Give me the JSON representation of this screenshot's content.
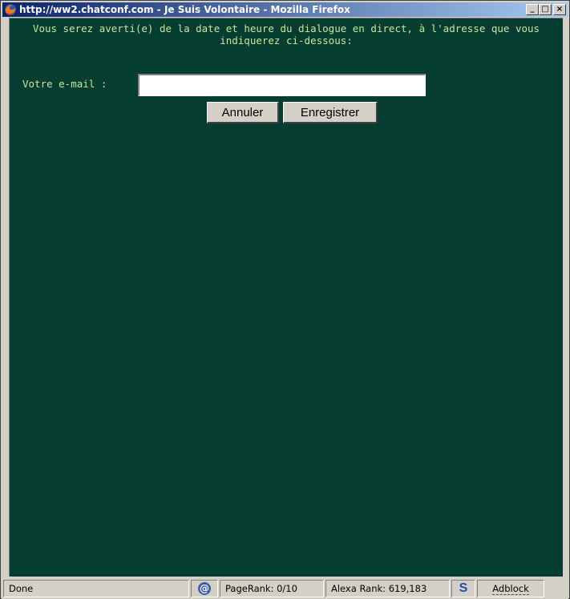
{
  "window": {
    "title": "http://ww2.chatconf.com - Je Suis Volontaire - Mozilla Firefox",
    "minimize_glyph": "_",
    "maximize_glyph": "□",
    "close_glyph": "×"
  },
  "form": {
    "message": "Vous serez averti(e) de la date et heure du dialogue en direct, à l'adresse que vous indiquerez ci-dessous:",
    "email_label": "Votre e-mail :",
    "email_value": "",
    "cancel_label": "Annuler",
    "save_label": "Enregistrer"
  },
  "statusbar": {
    "status_text": "Done",
    "pagerank_text": "PageRank: 0/10",
    "alexa_text": "Alexa Rank: 619,183",
    "s_icon_glyph": "S",
    "at_icon_glyph": "@",
    "adblock_text": "Adblock"
  },
  "colors": {
    "content_bg": "#053d31",
    "content_text": "#c9e6a0",
    "titlebar_start": "#0a246a",
    "titlebar_end": "#a6caf0",
    "chrome": "#d4d0c8"
  }
}
